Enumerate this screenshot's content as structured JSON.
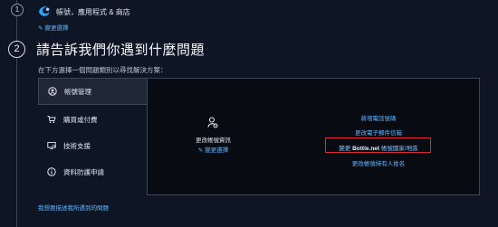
{
  "step1": {
    "number": "1",
    "title": "帳號，應用程式 & 商店",
    "change_label": "變更選擇"
  },
  "step2": {
    "number": "2",
    "heading": "請告訴我們你遇到什麼問題",
    "subheading": "在下方選擇一個問題類別以尋找解決方案："
  },
  "categories": [
    {
      "label": "帳號管理",
      "icon": "user-circle-icon",
      "selected": true
    },
    {
      "label": "購買或付費",
      "icon": "cart-icon",
      "selected": false
    },
    {
      "label": "技術支援",
      "icon": "monitor-icon",
      "selected": false
    },
    {
      "label": "資料防護申請",
      "icon": "info-icon",
      "selected": false
    }
  ],
  "middle_panel": {
    "label": "更改帳號資訊",
    "change_label": "變更選擇",
    "icon": "account-gear-icon"
  },
  "right_panel": {
    "links": [
      "新增電話號碼",
      "更改電子郵件信箱",
      "更改帳號持有人姓名"
    ],
    "highlighted_link": {
      "prefix": "變更",
      "bold": "Bottle.net",
      "suffix": "帳號國家/地區"
    }
  },
  "bottom_link": "我想要描述我所遇到的問題",
  "colors": {
    "background": "#0e1626",
    "panel": "#080b12",
    "link": "#5fb6ff",
    "highlight_border": "#e0282e"
  }
}
